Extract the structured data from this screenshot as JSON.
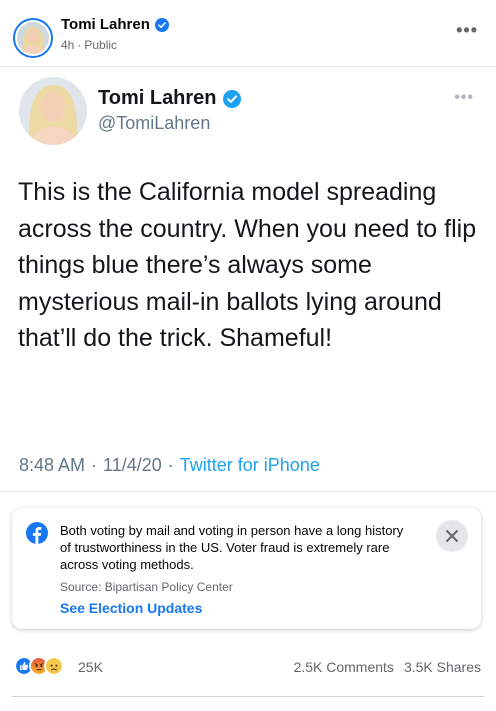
{
  "post": {
    "author": "Tomi Lahren",
    "time": "4h",
    "separator": "·",
    "visibility": "Public",
    "more_label": "•••"
  },
  "tweet": {
    "name": "Tomi Lahren",
    "handle": "@TomiLahren",
    "more_label": "•••",
    "text": "This is the California model spreading across the country. When you need to flip things blue there’s always some mysterious mail-in ballots lying around that’ll do the trick. Shameful!",
    "time": "8:48 AM",
    "date": "11/4/20",
    "separator": "·",
    "source": "Twitter for iPhone"
  },
  "notice": {
    "text": "Both voting by mail and voting in person have a long history of trustworthiness in the US. Voter fraud is extremely rare across voting methods.",
    "source": "Source: Bipartisan Policy Center",
    "link": "See Election Updates"
  },
  "engagement": {
    "reaction_count": "25K",
    "comments": "2.5K Comments",
    "shares": "3.5K Shares",
    "reactions": [
      "like-icon",
      "angry-icon",
      "sad-icon"
    ]
  },
  "colors": {
    "facebook_blue": "#1877f2",
    "twitter_blue": "#1da1f2",
    "secondary_text": "#65676b"
  }
}
